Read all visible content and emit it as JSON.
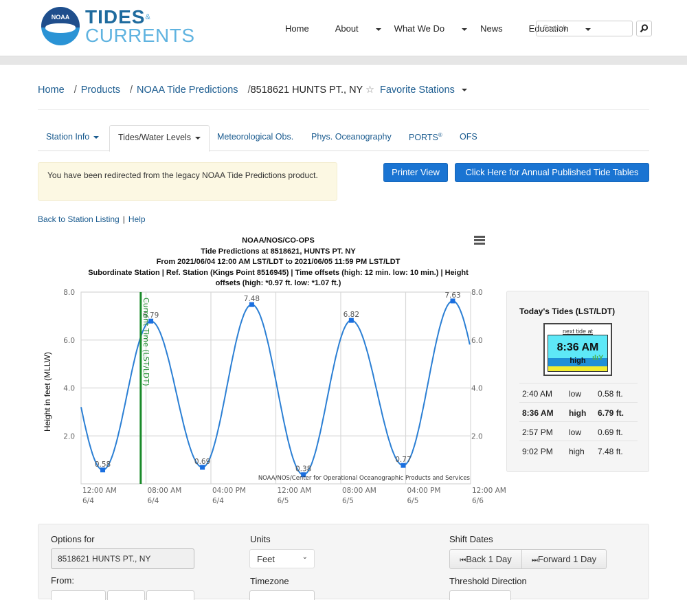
{
  "header": {
    "logo_badge": "NOAA",
    "logo_line1": "TIDES",
    "logo_amp": "&",
    "logo_line2": "CURRENTS",
    "nav": [
      "Home",
      "About",
      "What We Do",
      "News",
      "Education"
    ],
    "search_placeholder": "Search",
    "search_icon": "magnifier-icon"
  },
  "breadcrumb": {
    "items": [
      "Home",
      "Products",
      "NOAA Tide Predictions"
    ],
    "current": "8518621 HUNTS PT., NY",
    "favorite_label": "Favorite Stations",
    "star_icon": "☆"
  },
  "tabs": [
    "Station Info",
    "Tides/Water Levels",
    "Meteorological Obs.",
    "Phys. Oceanography",
    "PORTS",
    "OFS"
  ],
  "tabs_ports_sup": "®",
  "alert": "You have been redirected from the legacy NOAA Tide Predictions product.",
  "buttons": {
    "printer": "Printer View",
    "annual": "Click Here for Annual Published Tide Tables"
  },
  "links": {
    "back": "Back to Station Listing",
    "sep": "|",
    "help": "Help"
  },
  "chart_data": {
    "type": "line",
    "title_lines": [
      "NOAA/NOS/CO-OPS",
      "Tide Predictions at 8518621, HUNTS PT. NY",
      "From 2021/06/04 12:00 AM LST/LDT to 2021/06/05 11:59 PM LST/LDT",
      "Subordinate Station | Ref. Station (Kings Point 8516945) | Time offsets (high: 12 min. low: 10 min.) | Height",
      "offsets (high: *0.97 ft. low: *1.07 ft.)"
    ],
    "ylabel": "Height in feet (MLLW)",
    "ylim": [
      0,
      8
    ],
    "yticks": [
      "8.0",
      "6.0",
      "4.0",
      "2.0"
    ],
    "ytick_values": [
      8,
      6,
      4,
      2
    ],
    "xlim_hours": [
      0,
      48
    ],
    "xticks": [
      {
        "time": "12:00 AM",
        "date": "6/4",
        "hour": 0
      },
      {
        "time": "08:00 AM",
        "date": "6/4",
        "hour": 8
      },
      {
        "time": "04:00 PM",
        "date": "6/4",
        "hour": 16
      },
      {
        "time": "12:00 AM",
        "date": "6/5",
        "hour": 24
      },
      {
        "time": "08:00 AM",
        "date": "6/5",
        "hour": 32
      },
      {
        "time": "04:00 PM",
        "date": "6/5",
        "hour": 40
      },
      {
        "time": "12:00 AM",
        "date": "6/6",
        "hour": 48
      }
    ],
    "grid": true,
    "extremes": [
      {
        "hour": 2.67,
        "value": 0.58,
        "label": "0.58"
      },
      {
        "hour": 8.6,
        "value": 6.79,
        "label": "6.79"
      },
      {
        "hour": 14.95,
        "value": 0.69,
        "label": "0.69"
      },
      {
        "hour": 21.03,
        "value": 7.48,
        "label": "7.48"
      },
      {
        "hour": 27.4,
        "value": 0.38,
        "label": "0.38"
      },
      {
        "hour": 33.3,
        "value": 6.82,
        "label": "6.82"
      },
      {
        "hour": 39.7,
        "value": 0.77,
        "label": "0.77"
      },
      {
        "hour": 45.8,
        "value": 7.63,
        "label": "7.63"
      }
    ],
    "start_value": 3.1,
    "end_value": 5.9,
    "current_time_hour": 7.35,
    "current_time_label": "Current Time (LST/LDT)",
    "credit": "NOAA/NOS/Center for Operational Oceanographic Products and Services",
    "series_color": "#2b7fd4",
    "current_time_color": "#1a8a2a"
  },
  "todays_tides": {
    "title": "Today's Tides (LST/LDT)",
    "widget": {
      "next_label": "next tide at",
      "time": "8:36 AM",
      "type": "high"
    },
    "rows": [
      {
        "time": "2:40 AM",
        "type": "low",
        "height": "0.58 ft.",
        "bold": false
      },
      {
        "time": "8:36 AM",
        "type": "high",
        "height": "6.79 ft.",
        "bold": true
      },
      {
        "time": "2:57 PM",
        "type": "low",
        "height": "0.69 ft.",
        "bold": false
      },
      {
        "time": "9:02 PM",
        "type": "high",
        "height": "7.48 ft.",
        "bold": false
      }
    ]
  },
  "options": {
    "options_for_label": "Options for",
    "station_value": "8518621 HUNTS PT., NY",
    "from_label": "From:",
    "units_label": "Units",
    "units_value": "Feet",
    "timezone_label": "Timezone",
    "shift_label": "Shift Dates",
    "back_day": "Back 1 Day",
    "forward_day": "Forward 1 Day",
    "threshold_label": "Threshold Direction"
  }
}
